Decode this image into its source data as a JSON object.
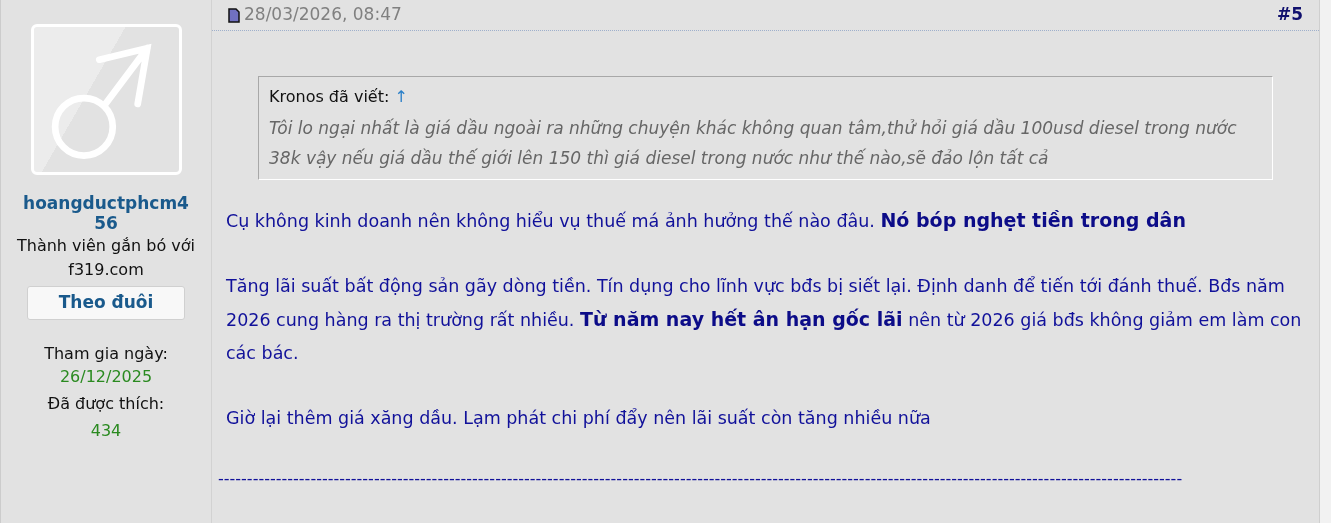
{
  "user": {
    "username": "hoangductphcm456",
    "rank": "Thành viên gắn bó với f319.com",
    "follow_button": "Theo đuôi",
    "join_label": "Tham gia ngày:",
    "join_date": "26/12/2025",
    "likes_label": "Đã được thích:",
    "likes": "434"
  },
  "post": {
    "date": "28/03/2026, 08:47",
    "number": "#5",
    "quote": {
      "author_line": "Kronos đã viết:",
      "jump_link": "↑",
      "text": "Tôi lo ngại nhất là giá dầu ngoài ra những chuyện khác không quan tâm,thử hỏi giá dầu 100usd diesel trong nước 38k vậy nếu giá dầu thế giới lên 150 thì giá diesel trong nước như thế nào,sẽ đảo lộn tất cả"
    },
    "paragraphs": [
      "Cụ không kinh doanh nên không hiểu vụ thuế má ảnh hưởng thế nào đâu. **Nó bóp nghẹt tiền trong dân**",
      "Tăng lãi suất bất động sản gãy dòng tiền. Tín dụng cho lĩnh vực bđs bị siết lại. Định danh để tiến tới đánh thuế. Bđs năm 2026 cung hàng ra thị trường rất nhiều. **Từ năm nay hết ân hạn gốc lãi** nên từ 2026 giá bđs không giảm em làm con các bác.",
      "Giờ lại thêm giá xăng dầu. Lạm phát chi phí đẩy nên lãi suất còn tăng nhiều nữa"
    ],
    "signature": "-----------------------------------------------------------------------------------------------------------------------------------------------------------------------"
  }
}
